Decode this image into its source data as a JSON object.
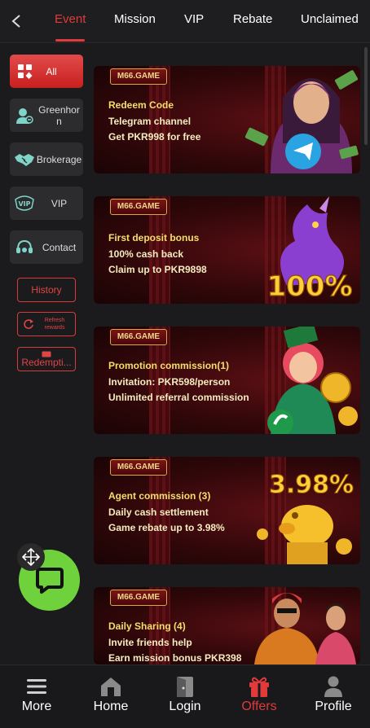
{
  "topnav": {
    "tabs": [
      {
        "label": "Event",
        "active": true
      },
      {
        "label": "Mission"
      },
      {
        "label": "VIP"
      },
      {
        "label": "Rebate"
      },
      {
        "label": "Unclaimed"
      }
    ]
  },
  "sidebar": {
    "items": [
      {
        "label": "All",
        "icon": "grid-suit-icon",
        "active": true
      },
      {
        "label": "Greenhorn",
        "icon": "newbie-user-icon"
      },
      {
        "label": "Brokerage",
        "icon": "handshake-icon"
      },
      {
        "label": "VIP",
        "icon": "vip-badge-icon"
      },
      {
        "label": "Contact",
        "icon": "headset-icon"
      }
    ],
    "history_label": "History",
    "refresh_label": "Refresh rewards",
    "redemption_label": "Redempti..."
  },
  "banners": [
    {
      "logo": "M66.GAME",
      "lines": [
        "Redeem Code",
        "Telegram channel",
        "Get PKR998 for free"
      ]
    },
    {
      "logo": "M66.GAME",
      "lines": [
        "First deposit bonus",
        "100% cash back",
        "Claim up to PKR9898"
      ],
      "art_text": "100%"
    },
    {
      "logo": "M66.GAME",
      "lines": [
        "Promotion commission(1)",
        "Invitation: PKR598/person",
        "Unlimited referral commission"
      ]
    },
    {
      "logo": "M66.GAME",
      "lines": [
        "Agent commission (3)",
        "Daily cash settlement",
        "Game rebate up to 3.98%"
      ],
      "art_text": "3.98%"
    },
    {
      "logo": "M66.GAME",
      "lines": [
        "Daily Sharing (4)",
        "Invite friends help",
        "Earn mission bonus PKR398"
      ]
    }
  ],
  "bottomnav": {
    "items": [
      {
        "label": "More",
        "icon": "menu-icon"
      },
      {
        "label": "Home",
        "icon": "home-icon"
      },
      {
        "label": "Login",
        "icon": "login-door-icon"
      },
      {
        "label": "Offers",
        "icon": "gift-icon",
        "active": true
      },
      {
        "label": "Profile",
        "icon": "profile-icon"
      }
    ]
  },
  "colors": {
    "accent": "#e03a3a",
    "chat": "#6fd23c",
    "banner_text": "#f5df6b"
  }
}
